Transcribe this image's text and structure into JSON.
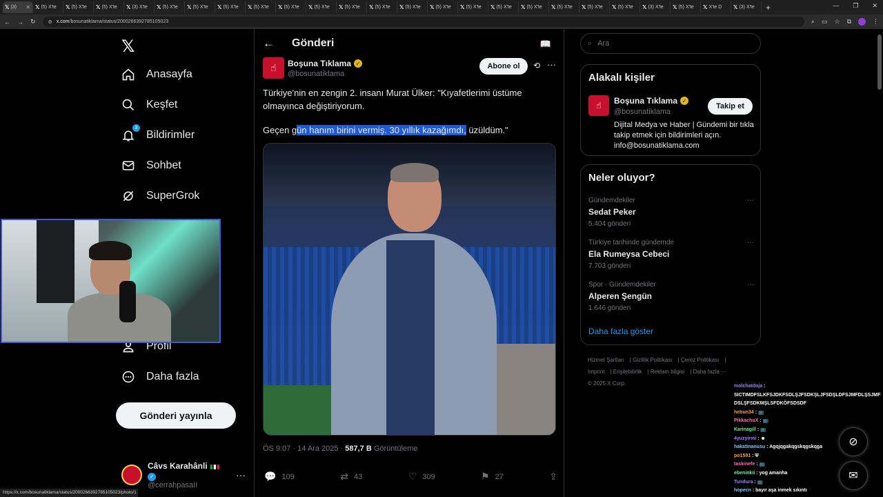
{
  "browser": {
    "tabs": [
      {
        "label": "(3)",
        "active": true
      },
      {
        "label": "(5) X'te"
      },
      {
        "label": "(5) X'te"
      },
      {
        "label": "(5) X'te"
      },
      {
        "label": "(3) X'te"
      },
      {
        "label": "(5) X'te"
      },
      {
        "label": "(5) X'te"
      },
      {
        "label": "(5) X'te"
      },
      {
        "label": "(5) X'te"
      },
      {
        "label": "(5) X'te"
      },
      {
        "label": "(5) X'te"
      },
      {
        "label": "(5) X'te"
      },
      {
        "label": "(5) X'te"
      },
      {
        "label": "(5) X'te"
      },
      {
        "label": "(5) X'te"
      },
      {
        "label": "(5) X'te"
      },
      {
        "label": "(5) X'te"
      },
      {
        "label": "(5) X'te"
      },
      {
        "label": "(5) X'te"
      },
      {
        "label": "(5) X'te"
      },
      {
        "label": "(5) X'te"
      },
      {
        "label": "(3) X'te"
      },
      {
        "label": "(5) X'te"
      },
      {
        "label": "X'te D"
      },
      {
        "label": "(3) X'te"
      }
    ],
    "url_domain": "x.com",
    "url_path": "/bosunatiklama/status/2000266392785105023",
    "status_url": "https://x.com/bosunatiklama/status/2000266392785105023/photo/1"
  },
  "nav": {
    "items": [
      {
        "label": "Anasayfa",
        "icon": "home-icon"
      },
      {
        "label": "Keşfet",
        "icon": "search-icon"
      },
      {
        "label": "Bildirimler",
        "icon": "bell-icon",
        "badge": "3"
      },
      {
        "label": "Sohbet",
        "icon": "mail-icon"
      },
      {
        "label": "SuperGrok",
        "icon": "grok-icon"
      },
      {
        "label": "Profil",
        "icon": "profile-icon"
      },
      {
        "label": "Daha fazla",
        "icon": "more-circle-icon"
      }
    ],
    "post_button": "Gönderi yayınla",
    "me": {
      "name": "Câvs Karahânli",
      "handle": "@cerrahpasaII"
    }
  },
  "main": {
    "title": "Gönderi",
    "author": {
      "name": "Boşuna Tıklama",
      "handle": "@bosunatiklama"
    },
    "subscribe": "Abone ol",
    "text_line1": "Türkiye'nin en zengin 2. insanı Murat Ülker: \"Kıyafetlerimi üstüme olmayınca değiştiriyorum.",
    "text2_pre": "Geçen g",
    "text2_hl": "ün hanım birini vermiş. 30 yıllık kazağımdı,",
    "text2_post": " üzüldüm.\"",
    "time": "ÖS 9:07 · 14 Ara 2025 · ",
    "views": "587,7 B",
    "views_label": " Görüntüleme",
    "replies": "109",
    "reposts": "43",
    "likes": "309",
    "bookmarks": "27"
  },
  "right": {
    "search_placeholder": "Ara",
    "related_title": "Alakalı kişiler",
    "related": {
      "name": "Boşuna Tıklama",
      "handle": "@bosunatiklama",
      "follow": "Takip et",
      "bio": "Dijital Medya ve Haber | Gündemi bir tıkla takip etmek için bildirimleri açın. info@bosunatiklama.com"
    },
    "trends_title": "Neler oluyor?",
    "trends": [
      {
        "context": "Gündemdekiler",
        "name": "Sedat Peker",
        "count": "5.404 gönderi"
      },
      {
        "context": "Türkiye tarihinde gündemde",
        "name": "Ela Rumeysa Cebeci",
        "count": "7.703 gönderi"
      },
      {
        "context": "Spor · Gündemdekiler",
        "name": "Alperen Şengün",
        "count": "1.646 gönderi"
      }
    ],
    "show_more": "Daha fazla göster",
    "footer": [
      "Hizmet Şartları",
      "Gizlilik Politikası",
      "Çerez Politikası",
      "Imprint",
      "Erişilebilirlik",
      "Reklam bilgisi",
      "Daha fazla ···",
      "© 2025 X Corp."
    ]
  },
  "chat": [
    {
      "user": "molchatdoja",
      "msg": ""
    },
    {
      "user": "",
      "msg": "SICTIMDFSLKFSJDKFSDLŞJFSDKŞLJFSDŞLDFSJMFDLŞSJMF DSLŞFSDKMŞLSFDKÖFSDSDF"
    },
    {
      "user": "hebun34",
      "msg": "📺"
    },
    {
      "user": "PikkachuX",
      "msg": "📺"
    },
    {
      "user": "Karinagill",
      "msg": "📺"
    },
    {
      "user": "4yuzyirmi",
      "msg": "☻"
    },
    {
      "user": "hakatinanusu",
      "msg": "Agqjqgakqgskqgskqga"
    },
    {
      "user": "po1591",
      "msg": "⛨"
    },
    {
      "user": "taskinefe",
      "msg": "📺"
    },
    {
      "user": "ebeninkii",
      "msg": "yog amanha"
    },
    {
      "user": "Tundura",
      "msg": "📺"
    },
    {
      "user": "hopecn",
      "msg": "bayır aşa inmek sıkıntı"
    }
  ]
}
